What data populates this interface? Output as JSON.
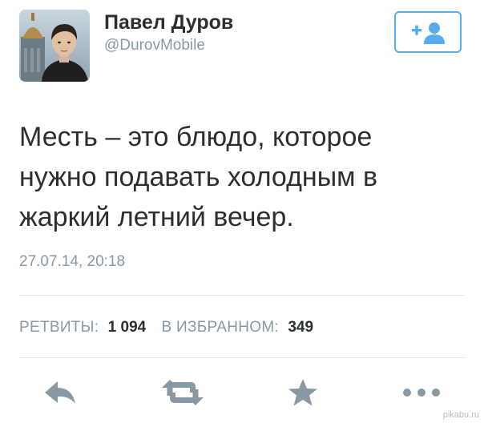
{
  "profile": {
    "name": "Павел Дуров",
    "handle": "@DurovMobile"
  },
  "tweet": {
    "text": "Месть – это блюдо, которое\nнужно подавать холодным в\nжаркий летний вечер.",
    "timestamp": "27.07.14, 20:18"
  },
  "stats": {
    "retweets_label": "РЕТВИТЫ:",
    "retweets_count": "1 094",
    "favorites_label": "В ИЗБРАННОМ:",
    "favorites_count": "349"
  },
  "actions": {
    "reply_icon": "reply-icon",
    "retweet_icon": "retweet-icon",
    "favorite_icon": "star-icon",
    "more_icon": "more-icon"
  },
  "follow_button_icon": "add-user-icon",
  "watermark": "pikabu.ru",
  "colors": {
    "accent": "#55acee",
    "text": "#292f33",
    "muted": "#8899a6",
    "icon": "#8899a6"
  }
}
